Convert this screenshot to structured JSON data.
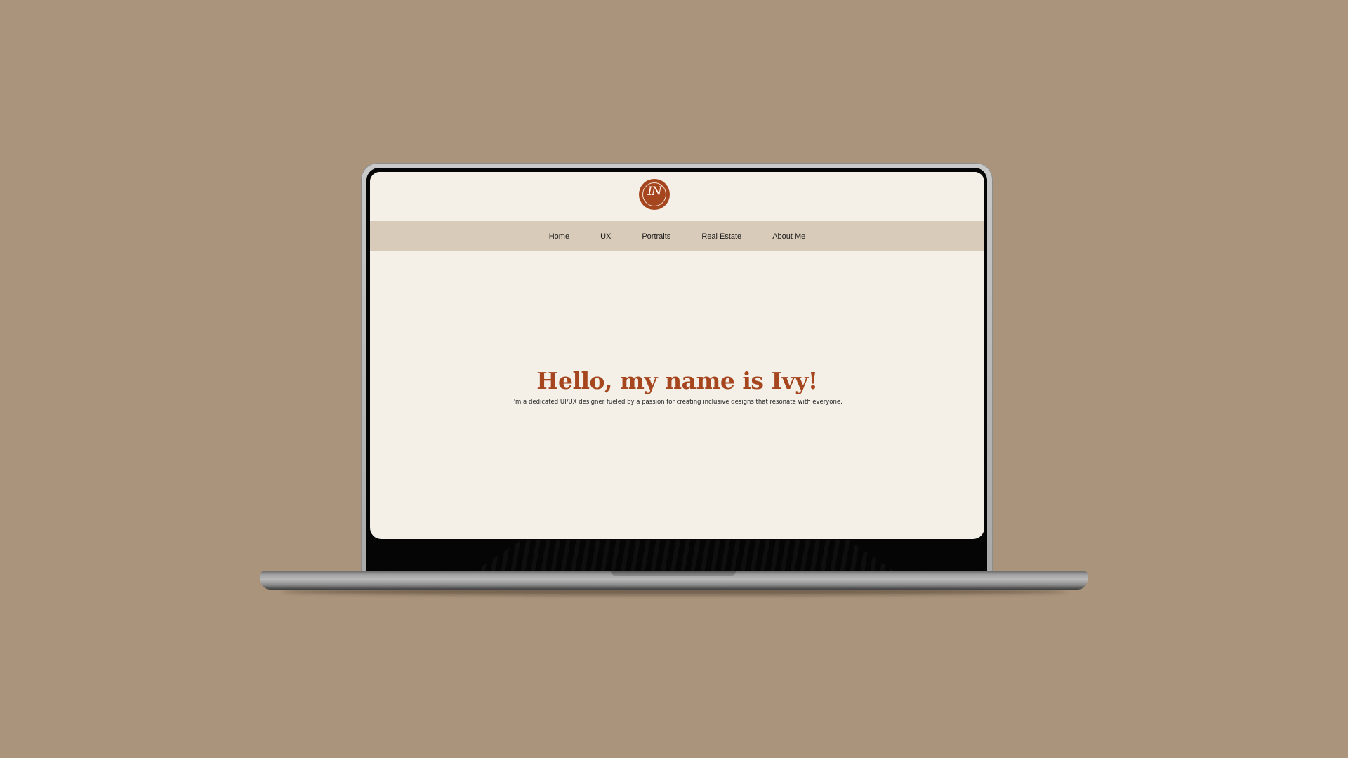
{
  "site": {
    "logo_text": "IN",
    "nav": [
      "Home",
      "UX",
      "Portraits",
      "Real Estate",
      "About Me"
    ],
    "hero": {
      "title": "Hello, my name is Ivy!",
      "subtitle": "I'm a dedicated UI/UX designer fueled by a passion for creating inclusive designs that resonate with everyone."
    }
  },
  "colors": {
    "background": "#ab947c",
    "page": "#f4f0e8",
    "nav_bar": "#d9cbb9",
    "accent": "#a5461f"
  }
}
